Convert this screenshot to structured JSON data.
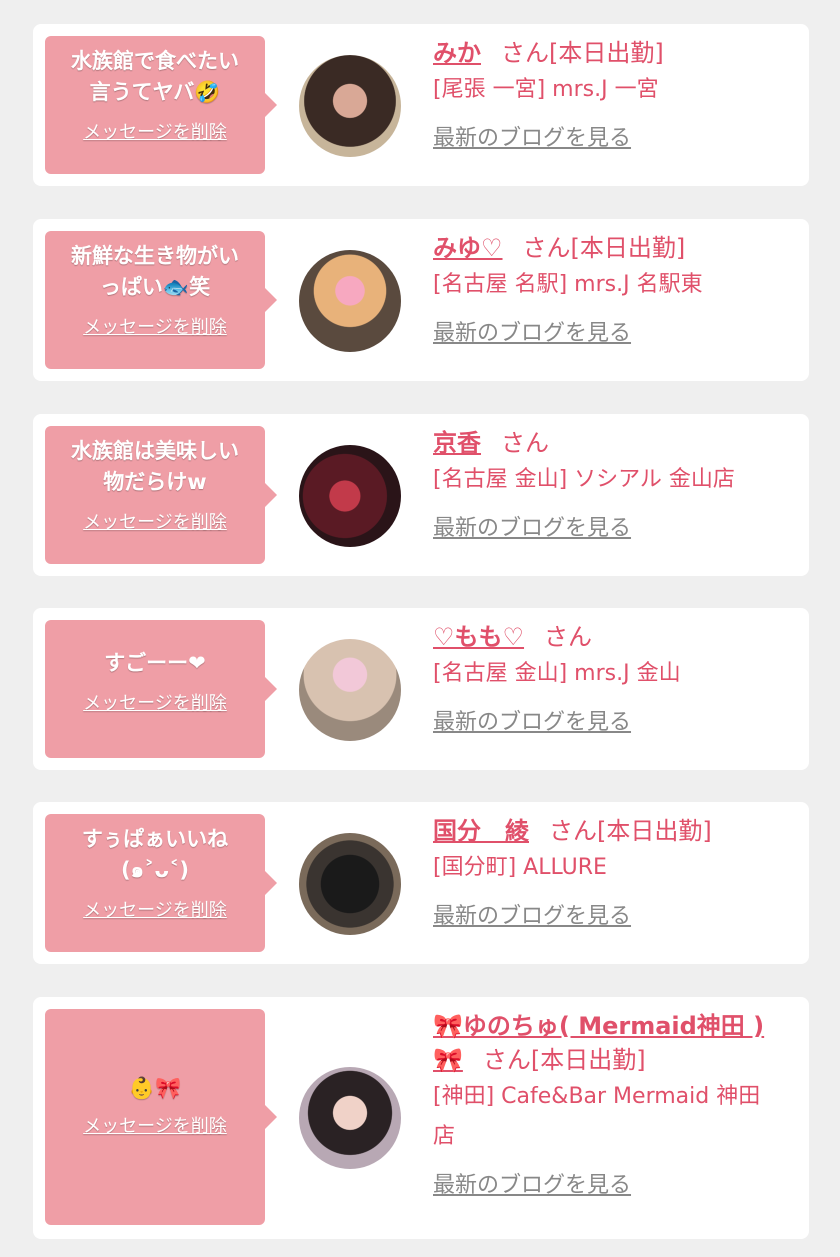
{
  "actions": {
    "delete_label": "メッセージを削除",
    "blog_label": "最新のブログを見る",
    "honorific": "さん"
  },
  "messages": [
    {
      "message": [
        "水族館で食べたい",
        "言うてヤバ🤣"
      ],
      "name": "みか",
      "status": "[本日出勤]",
      "shop": "[尾張 一宮] mrs.J 一宮"
    },
    {
      "message": [
        "新鮮な生き物がい",
        "っぱい🐟笑"
      ],
      "name": "みゆ♡",
      "status": "[本日出勤]",
      "shop": "[名古屋 名駅] mrs.J 名駅東"
    },
    {
      "message": [
        "水族館は美味しい",
        "物だらけw"
      ],
      "name": "京香",
      "status": "",
      "shop": "[名古屋 金山] ソシアル 金山店"
    },
    {
      "message": [
        "すごーー❤"
      ],
      "name": "♡もも♡",
      "status": "",
      "shop": "[名古屋 金山] mrs.J 金山"
    },
    {
      "message": [
        "すぅぱぁいいね",
        "(๑˃ᴗ˂)"
      ],
      "name": "国分　綾",
      "status": "[本日出勤]",
      "shop": "[国分町] ALLURE"
    },
    {
      "message": [
        "👶🎀"
      ],
      "name": "🎀ゆのちゅ( Mermaid神田 )",
      "name2": "🎀",
      "status": "[本日出勤]",
      "shop": [
        "[神田] Cafe&Bar Mermaid 神田",
        "店"
      ]
    }
  ]
}
